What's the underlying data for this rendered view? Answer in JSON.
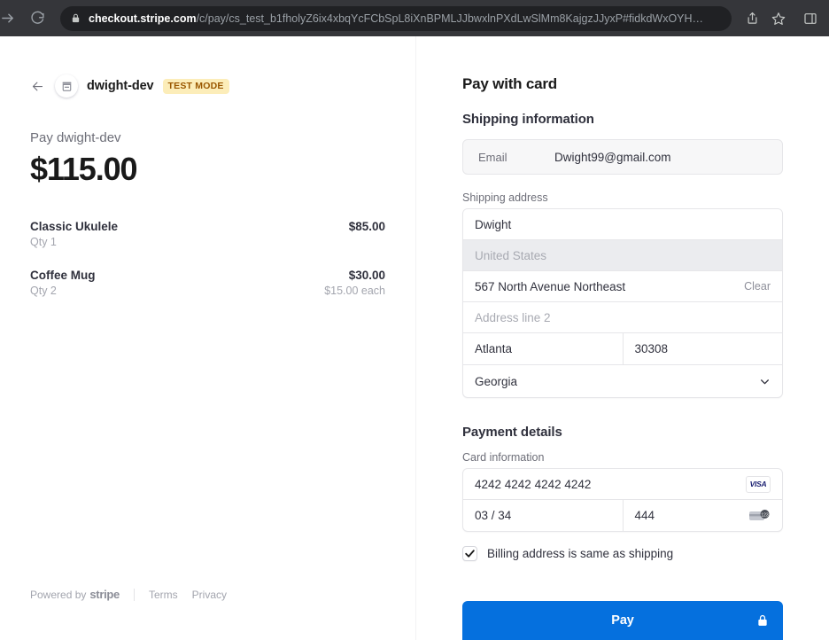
{
  "browser": {
    "url_host": "checkout.stripe.com",
    "url_path": "/c/pay/cs_test_b1fholyZ6ix4xbqYcFCbSpL8iXnBPMLJJbwxlnPXdLwSlMm8KajgzJJyxP#fidkdWxOYH…",
    "forward_label": "Forward",
    "reload_label": "Reload",
    "share_label": "Share",
    "bookmark_label": "Bookmark",
    "sidebar_label": "Toggle sidebar"
  },
  "left": {
    "back_label": "Back",
    "merchant_name": "dwight-dev",
    "test_badge": "TEST MODE",
    "pay_label": "Pay dwight-dev",
    "pay_amount": "$115.00",
    "items": [
      {
        "name": "Classic Ukulele",
        "amount": "$85.00",
        "qty": "Qty 1",
        "each": ""
      },
      {
        "name": "Coffee Mug",
        "amount": "$30.00",
        "qty": "Qty 2",
        "each": "$15.00 each"
      }
    ],
    "footer": {
      "powered_by": "Powered by",
      "stripe": "stripe",
      "terms": "Terms",
      "privacy": "Privacy"
    }
  },
  "right": {
    "title": "Pay with card",
    "shipping_heading": "Shipping information",
    "email_label": "Email",
    "email_value": "Dwight99@gmail.com",
    "shipping_address_label": "Shipping address",
    "name_value": "Dwight",
    "country_value": "United States",
    "address1_value": "567 North Avenue Northeast",
    "address1_clear": "Clear",
    "address2_placeholder": "Address line 2",
    "city_value": "Atlanta",
    "zip_value": "30308",
    "state_value": "Georgia",
    "payment_heading": "Payment details",
    "card_info_label": "Card information",
    "card_number": "4242 4242 4242 4242",
    "card_brand": "VISA",
    "card_expiry": "03 / 34",
    "card_cvc": "444",
    "billing_checkbox_label": "Billing address is same as shipping",
    "billing_checked": true,
    "pay_button": "Pay"
  },
  "colors": {
    "accent": "#0570de",
    "badge_bg": "#fcedb9",
    "badge_fg": "#9a5700",
    "chrome_bg": "#35363a",
    "omnibox_bg": "#202124",
    "visa_blue": "#1a1f71"
  }
}
